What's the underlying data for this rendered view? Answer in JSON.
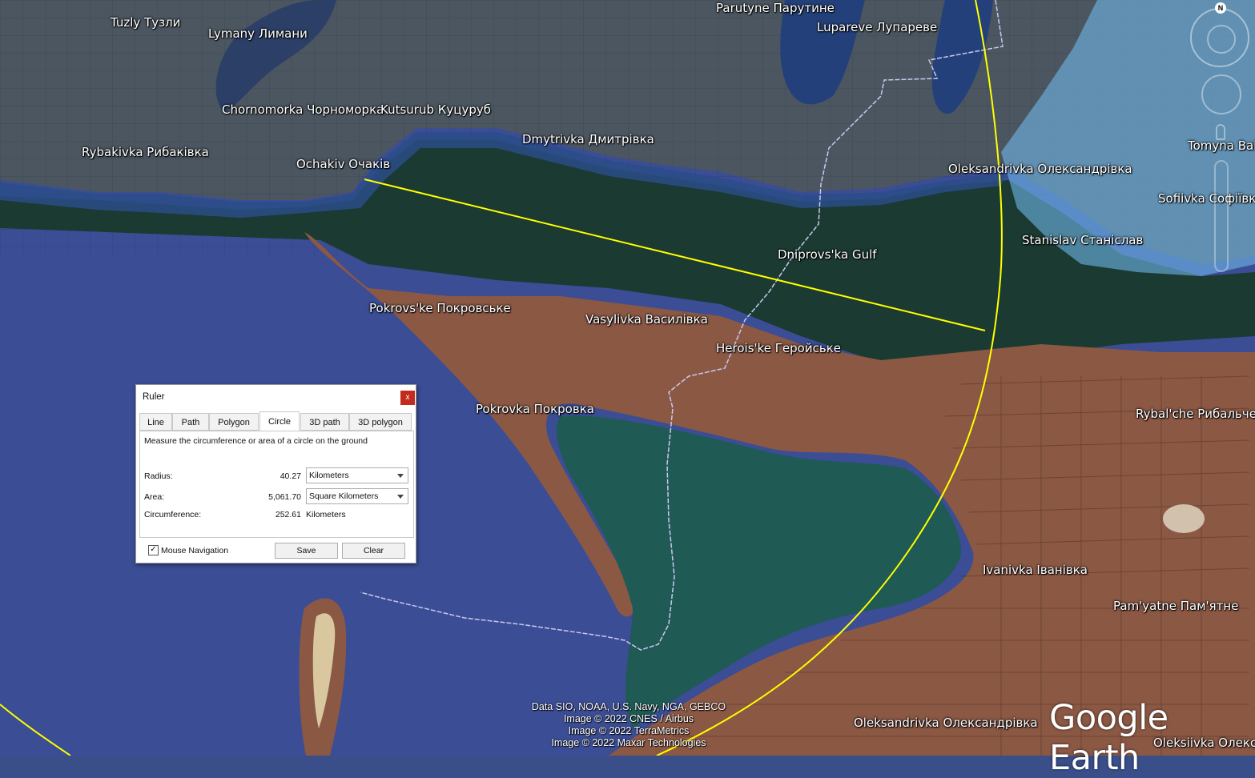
{
  "map": {
    "colors": {
      "water_open": "#3b4d95",
      "water_gulf": "#1a3a30",
      "land_north": "#4a5560",
      "land_south": "#8a5a45",
      "occupied_overlay": "#6fb7ea",
      "ruler_circle": "#ffff00",
      "border_line": "#c8c8f0"
    },
    "places": [
      {
        "name": "tuzly",
        "label": "Tuzly Тузли"
      },
      {
        "name": "lymany",
        "label": "Lymany Лимани"
      },
      {
        "name": "parutyne",
        "label": "Parutyne Парутине"
      },
      {
        "name": "lupareve",
        "label": "Lupareve Лупареве"
      },
      {
        "name": "chornomorka",
        "label": "Chornomorka Чорноморка"
      },
      {
        "name": "kutsurub",
        "label": "Kutsurub Куцуруб"
      },
      {
        "name": "rybakivka",
        "label": "Rybakivka Рибаківка"
      },
      {
        "name": "dmytrivka",
        "label": "Dmytrivka Дмитрівка"
      },
      {
        "name": "ochakiv",
        "label": "Ochakiv Очаків"
      },
      {
        "name": "oleksandrivka-north",
        "label": "Oleksandrivka Олександрівка"
      },
      {
        "name": "tomyna-balka",
        "label": "Tomyna Bal"
      },
      {
        "name": "sofiivka",
        "label": "Sofiivka Софіївк"
      },
      {
        "name": "stanislav",
        "label": "Stanislav Станіслав"
      },
      {
        "name": "dniprovska-gulf",
        "label": "Dniprovs'ka Gulf"
      },
      {
        "name": "pokrovske",
        "label": "Pokrovs'ke Покровське"
      },
      {
        "name": "vasylivka",
        "label": "Vasylivka Василівка"
      },
      {
        "name": "heroiske",
        "label": "Herois'ke Геройське"
      },
      {
        "name": "pokrovka",
        "label": "Pokrovka Покровка"
      },
      {
        "name": "rybalche",
        "label": "Rybal'che Рибальче"
      },
      {
        "name": "ivanivka",
        "label": "Ivanivka Іванівка"
      },
      {
        "name": "pamyatne",
        "label": "Pam'yatne Пам'ятне"
      },
      {
        "name": "oleksandrivka-south",
        "label": "Oleksandrivka Олександрівка"
      },
      {
        "name": "oleksiivka",
        "label": "Oleksiivka Олексіїв"
      }
    ],
    "attribution": [
      "Data SIO, NOAA, U.S. Navy, NGA, GEBCO",
      "Image © 2022 CNES / Airbus",
      "Image © 2022 TerraMetrics",
      "Image © 2022 Maxar Technologies"
    ],
    "logo": "Google Earth",
    "compass_label": "N"
  },
  "ruler": {
    "title": "Ruler",
    "close_label": "x",
    "tabs": [
      "Line",
      "Path",
      "Polygon",
      "Circle",
      "3D path",
      "3D polygon"
    ],
    "active_tab": "Circle",
    "description": "Measure the circumference or area of a circle on the ground",
    "radius": {
      "label": "Radius:",
      "value": "40.27",
      "unit": "Kilometers"
    },
    "area": {
      "label": "Area:",
      "value": "5,061.70",
      "unit": "Square Kilometers"
    },
    "circumference": {
      "label": "Circumference:",
      "value": "252.61",
      "unit": "Kilometers"
    },
    "mouse_navigation": {
      "label": "Mouse Navigation",
      "checked": true,
      "check_mark": "✓"
    },
    "save_label": "Save",
    "clear_label": "Clear"
  }
}
